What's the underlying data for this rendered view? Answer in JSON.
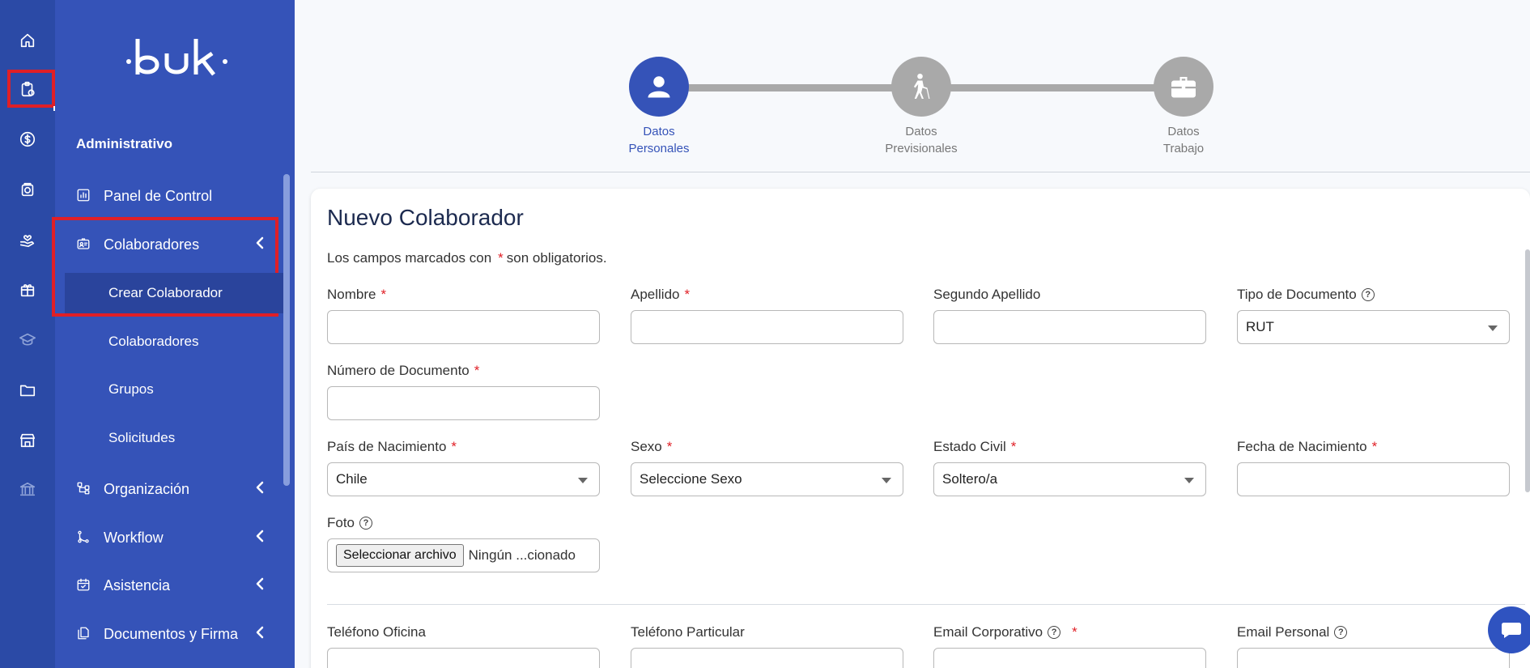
{
  "brand": {
    "logo_text": "·buk·"
  },
  "sidebar": {
    "section": "Administrativo",
    "items": [
      {
        "label": "Panel de Control"
      },
      {
        "label": "Colaboradores"
      },
      {
        "label": "Organización"
      },
      {
        "label": "Workflow"
      },
      {
        "label": "Asistencia"
      },
      {
        "label": "Documentos y Firma"
      }
    ],
    "subitems": [
      {
        "label": "Crear Colaborador"
      },
      {
        "label": "Colaboradores"
      },
      {
        "label": "Grupos"
      },
      {
        "label": "Solicitudes"
      }
    ]
  },
  "rail_icons": [
    "home-icon",
    "clipboard-clock-icon",
    "dollar-icon",
    "safe-icon",
    "hand-heart-icon",
    "gift-icon",
    "graduation-cap-icon",
    "folder-icon",
    "store-icon",
    "bank-icon"
  ],
  "stepper": {
    "steps": [
      {
        "line1": "Datos",
        "line2": "Personales"
      },
      {
        "line1": "Datos",
        "line2": "Previsionales"
      },
      {
        "line1": "Datos",
        "line2": "Trabajo"
      }
    ]
  },
  "form": {
    "title": "Nuevo Colaborador",
    "req_note_pre": "Los campos marcados con",
    "req_note_post": "son obligatorios.",
    "star": "*",
    "help": "?",
    "labels": {
      "nombre": "Nombre",
      "apellido": "Apellido",
      "segundo_apellido": "Segundo Apellido",
      "tipo_documento": "Tipo de Documento",
      "numero_documento": "Número de Documento",
      "pais_nacimiento": "País de Nacimiento",
      "sexo": "Sexo",
      "estado_civil": "Estado Civil",
      "fecha_nacimiento": "Fecha de Nacimiento",
      "foto": "Foto",
      "telefono_oficina": "Teléfono Oficina",
      "telefono_particular": "Teléfono Particular",
      "email_corporativo": "Email Corporativo",
      "email_personal": "Email Personal"
    },
    "values": {
      "tipo_documento": "RUT",
      "pais_nacimiento": "Chile",
      "sexo": "Seleccione Sexo",
      "estado_civil": "Soltero/a"
    },
    "file": {
      "button": "Seleccionar archivo",
      "status": "Ningún ...cionado"
    }
  },
  "colors": {
    "rail": "#2b4aa6",
    "sidebar": "#3553b8",
    "accent": "#3553b8",
    "highlight": "#e01f26",
    "step_inactive": "#a9a9a9"
  }
}
